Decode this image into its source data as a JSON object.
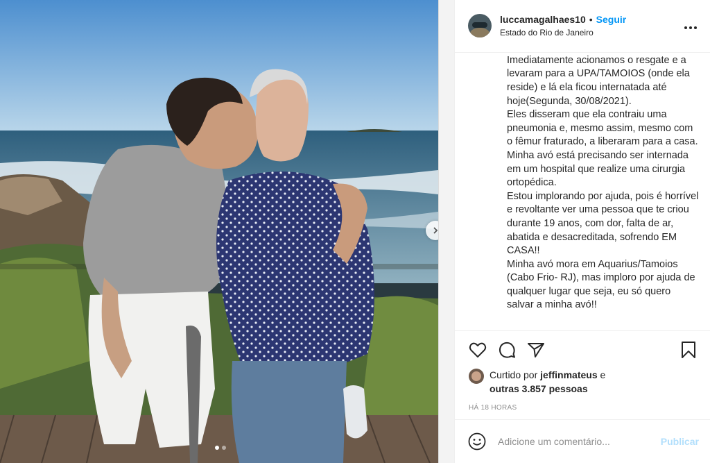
{
  "header": {
    "username": "luccamagalhaes10",
    "separator": "•",
    "follow_label": "Seguir",
    "location": "Estado do Rio de Janeiro",
    "more_icon": "more-options-icon"
  },
  "caption": {
    "lines": [
      "Imediatamente acionamos o resgate e a levaram para a UPA/TAMOIOS (onde ela reside) e lá ela ficou internatada até hoje(Segunda, 30/08/2021).",
      "Eles disseram que ela contraiu uma pneumonia e, mesmo assim, mesmo com o fêmur fraturado, a liberaram para a casa.",
      "Minha avó está precisando ser internada em um hospital que realize uma cirurgia ortopédica.",
      "Estou implorando por ajuda, pois é horrível e revoltante ver uma pessoa que te criou durante 19 anos, com dor, falta de ar, abatida e desacreditada, sofrendo EM CASA!!",
      "Minha avó mora em Aquarius/Tamoios (Cabo Frio- RJ), mas imploro por ajuda de qualquer lugar que seja, eu só quero salvar a minha avó!!"
    ]
  },
  "actions": {
    "icons": [
      "heart-icon",
      "comment-icon",
      "share-icon",
      "bookmark-icon"
    ]
  },
  "likes": {
    "prefix": "Curtido por",
    "liker": "jeffinmateus",
    "connector": "e",
    "others": "outras 3.857 pessoas"
  },
  "timestamp": "HÁ 18 HORAS",
  "comment_box": {
    "placeholder": "Adicione um comentário...",
    "publish_label": "Publicar"
  },
  "carousel": {
    "slides": 2,
    "active_slide": 1
  },
  "colors": {
    "link_blue": "#0095f6",
    "publish_disabled": "#b2dffc",
    "muted_text": "#8e8e8e"
  }
}
